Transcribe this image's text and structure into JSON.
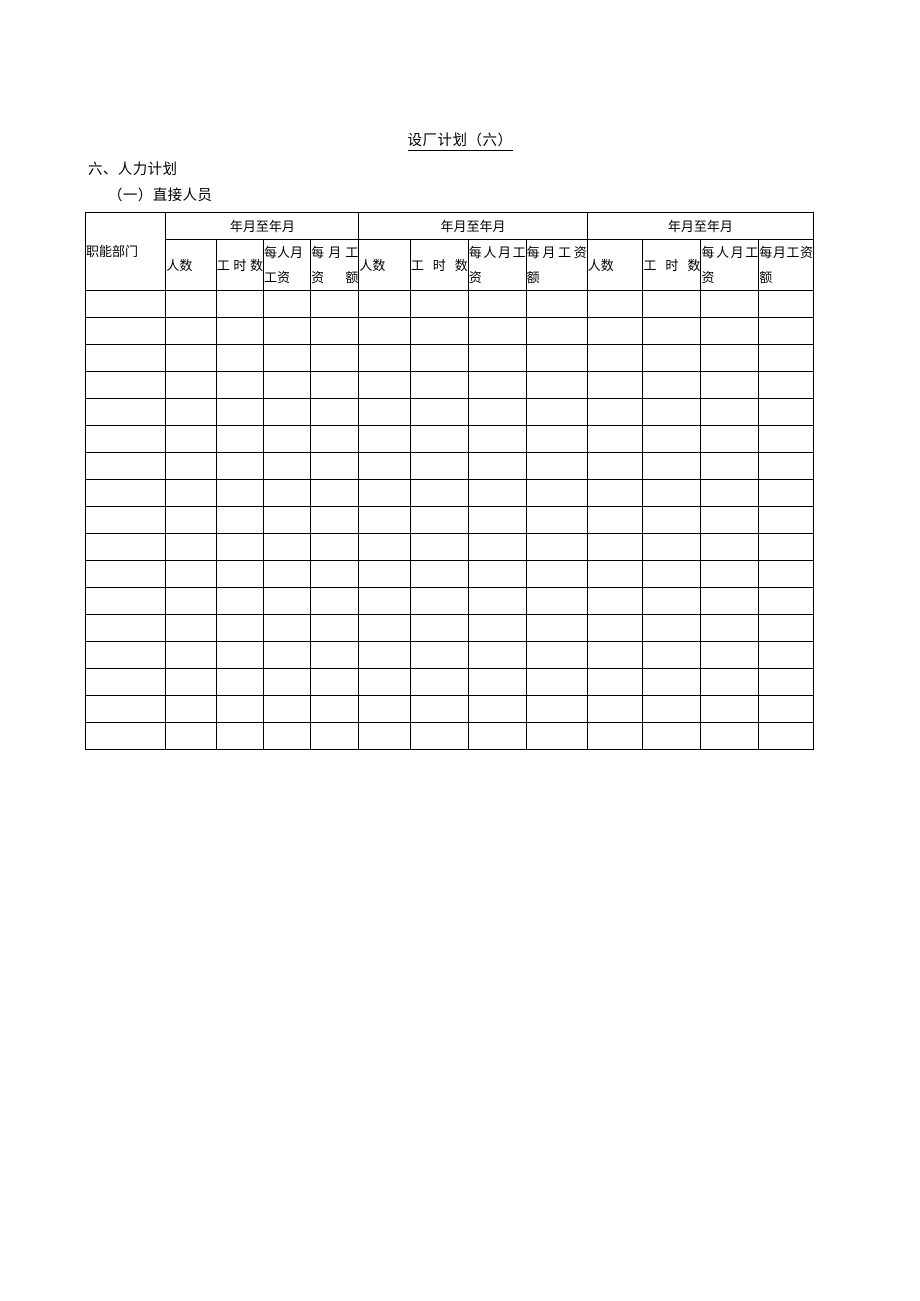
{
  "document": {
    "title": "设厂计划（六）",
    "section_heading": "六、人力计划",
    "subsection_heading": "（一）直接人员"
  },
  "table": {
    "row_header_label": "职能部门",
    "group_header_label": "年月至年月",
    "groups": [
      {
        "period_label": "年月至年月",
        "columns": [
          "人数",
          "工时数",
          "每人月工资",
          "每月工资额"
        ]
      },
      {
        "period_label": "年月至年月",
        "columns": [
          "人数",
          "工时数",
          "每人月工资",
          "每月工资额"
        ]
      },
      {
        "period_label": "年月至年月",
        "columns": [
          "人数",
          "工时数",
          "每人月工资",
          "每月工资额"
        ]
      }
    ],
    "column_count": 13,
    "body_row_count": 17,
    "body_rows": [
      [
        "",
        "",
        "",
        "",
        "",
        "",
        "",
        "",
        "",
        "",
        "",
        "",
        ""
      ],
      [
        "",
        "",
        "",
        "",
        "",
        "",
        "",
        "",
        "",
        "",
        "",
        "",
        ""
      ],
      [
        "",
        "",
        "",
        "",
        "",
        "",
        "",
        "",
        "",
        "",
        "",
        "",
        ""
      ],
      [
        "",
        "",
        "",
        "",
        "",
        "",
        "",
        "",
        "",
        "",
        "",
        "",
        ""
      ],
      [
        "",
        "",
        "",
        "",
        "",
        "",
        "",
        "",
        "",
        "",
        "",
        "",
        ""
      ],
      [
        "",
        "",
        "",
        "",
        "",
        "",
        "",
        "",
        "",
        "",
        "",
        "",
        ""
      ],
      [
        "",
        "",
        "",
        "",
        "",
        "",
        "",
        "",
        "",
        "",
        "",
        "",
        ""
      ],
      [
        "",
        "",
        "",
        "",
        "",
        "",
        "",
        "",
        "",
        "",
        "",
        "",
        ""
      ],
      [
        "",
        "",
        "",
        "",
        "",
        "",
        "",
        "",
        "",
        "",
        "",
        "",
        ""
      ],
      [
        "",
        "",
        "",
        "",
        "",
        "",
        "",
        "",
        "",
        "",
        "",
        "",
        ""
      ],
      [
        "",
        "",
        "",
        "",
        "",
        "",
        "",
        "",
        "",
        "",
        "",
        "",
        ""
      ],
      [
        "",
        "",
        "",
        "",
        "",
        "",
        "",
        "",
        "",
        "",
        "",
        "",
        ""
      ],
      [
        "",
        "",
        "",
        "",
        "",
        "",
        "",
        "",
        "",
        "",
        "",
        "",
        ""
      ],
      [
        "",
        "",
        "",
        "",
        "",
        "",
        "",
        "",
        "",
        "",
        "",
        "",
        ""
      ],
      [
        "",
        "",
        "",
        "",
        "",
        "",
        "",
        "",
        "",
        "",
        "",
        "",
        ""
      ],
      [
        "",
        "",
        "",
        "",
        "",
        "",
        "",
        "",
        "",
        "",
        "",
        "",
        ""
      ],
      [
        "",
        "",
        "",
        "",
        "",
        "",
        "",
        "",
        "",
        "",
        "",
        "",
        ""
      ]
    ]
  },
  "style": {
    "border_color": "#000000",
    "text_color": "#000000",
    "background": "#ffffff"
  }
}
